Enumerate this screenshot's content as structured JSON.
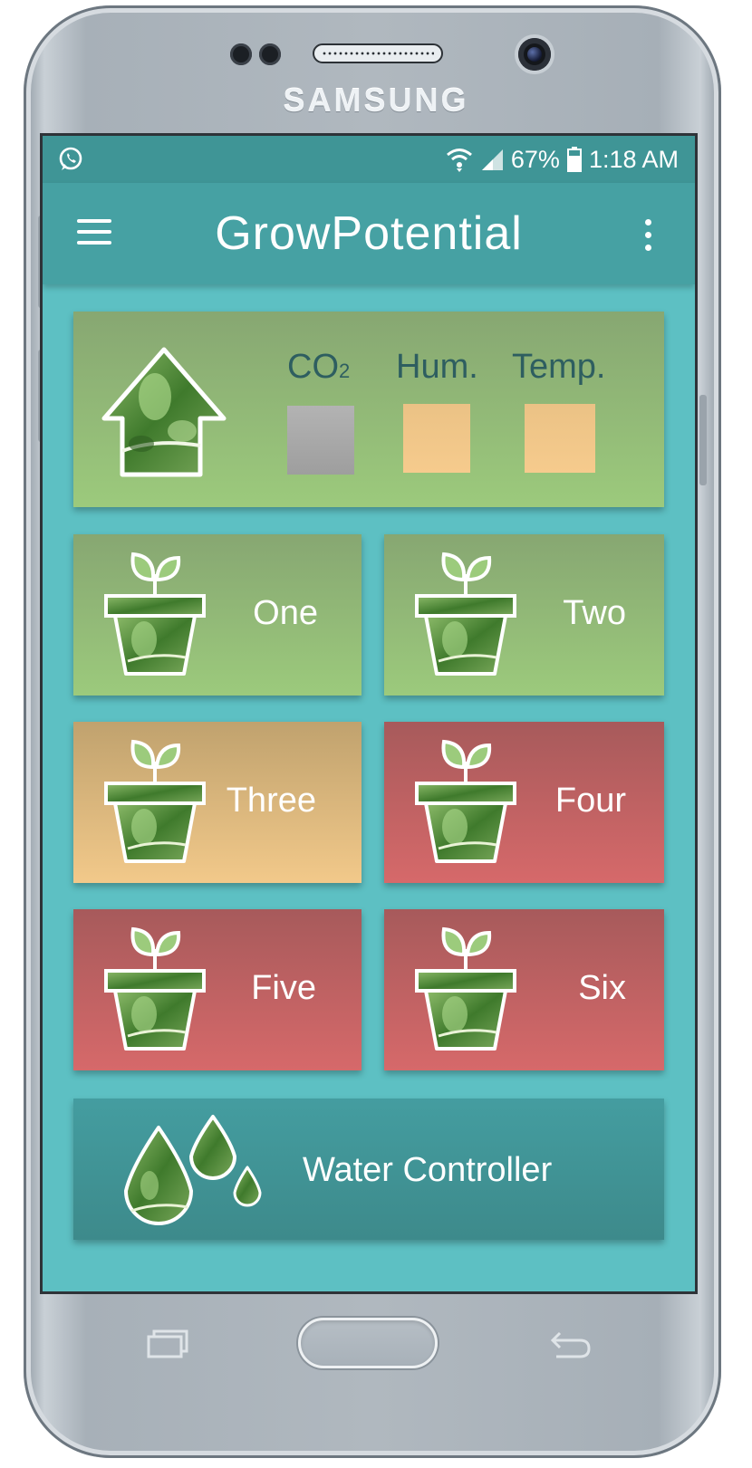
{
  "device": {
    "brand": "SAMSUNG"
  },
  "status_bar": {
    "battery": "67%",
    "time": "1:18 AM",
    "icons": [
      "whatsapp-icon",
      "wifi-icon",
      "signal-icon",
      "battery-icon"
    ]
  },
  "app_bar": {
    "title": "GrowPotential",
    "icons": [
      "menu-icon",
      "more-options-icon"
    ]
  },
  "environment": {
    "labels": {
      "co2_main": "CO",
      "co2_sub": "2",
      "humidity": "Hum.",
      "temperature": "Temp."
    },
    "status_colors": {
      "co2": "#a8a8a8",
      "humidity": "#f2c88b",
      "temperature": "#f2c88b"
    }
  },
  "plants": [
    {
      "label": "One",
      "status_color": "#96c07a"
    },
    {
      "label": "Two",
      "status_color": "#96c07a"
    },
    {
      "label": "Three",
      "status_color": "#e4bd80"
    },
    {
      "label": "Four",
      "status_color": "#cc6465"
    },
    {
      "label": "Five",
      "status_color": "#cc6465"
    },
    {
      "label": "Six",
      "status_color": "#cc6465"
    }
  ],
  "water_controller": {
    "label": "Water Controller"
  },
  "nav_keys": [
    "recent-apps-icon",
    "home-button",
    "back-icon"
  ]
}
